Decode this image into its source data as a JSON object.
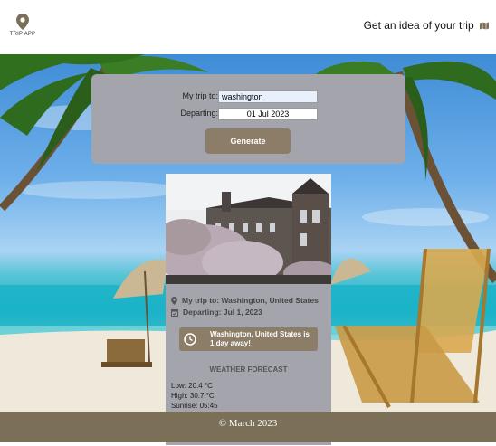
{
  "header": {
    "logo_icon": "map-pin-icon",
    "logo_text": "TRIP APP",
    "tagline": "Get an idea of your trip",
    "tagline_icon": "map-icon"
  },
  "form": {
    "destination_label": "My trip to:",
    "destination_value": "washington",
    "departing_label": "Departing:",
    "departing_value": "01 Jul 2023",
    "generate_label": "Generate"
  },
  "trip_card": {
    "photo_alt": "Washington",
    "trip_line": "My trip to: Washington, United States",
    "departing_line": "Departing: Jul 1, 2023",
    "countdown": "Washington, United States is 1 day away!",
    "weather_title": "WEATHER FORECAST",
    "weather": {
      "low": "Low: 20.4 °C",
      "high": "High: 30.7 °C",
      "sunrise": "Sunrise: 05:45"
    }
  },
  "footer": {
    "text": "© March 2023"
  },
  "colors": {
    "accent": "#8b7d68",
    "panel": "#a3a4ac",
    "footer": "#7b6f58"
  }
}
